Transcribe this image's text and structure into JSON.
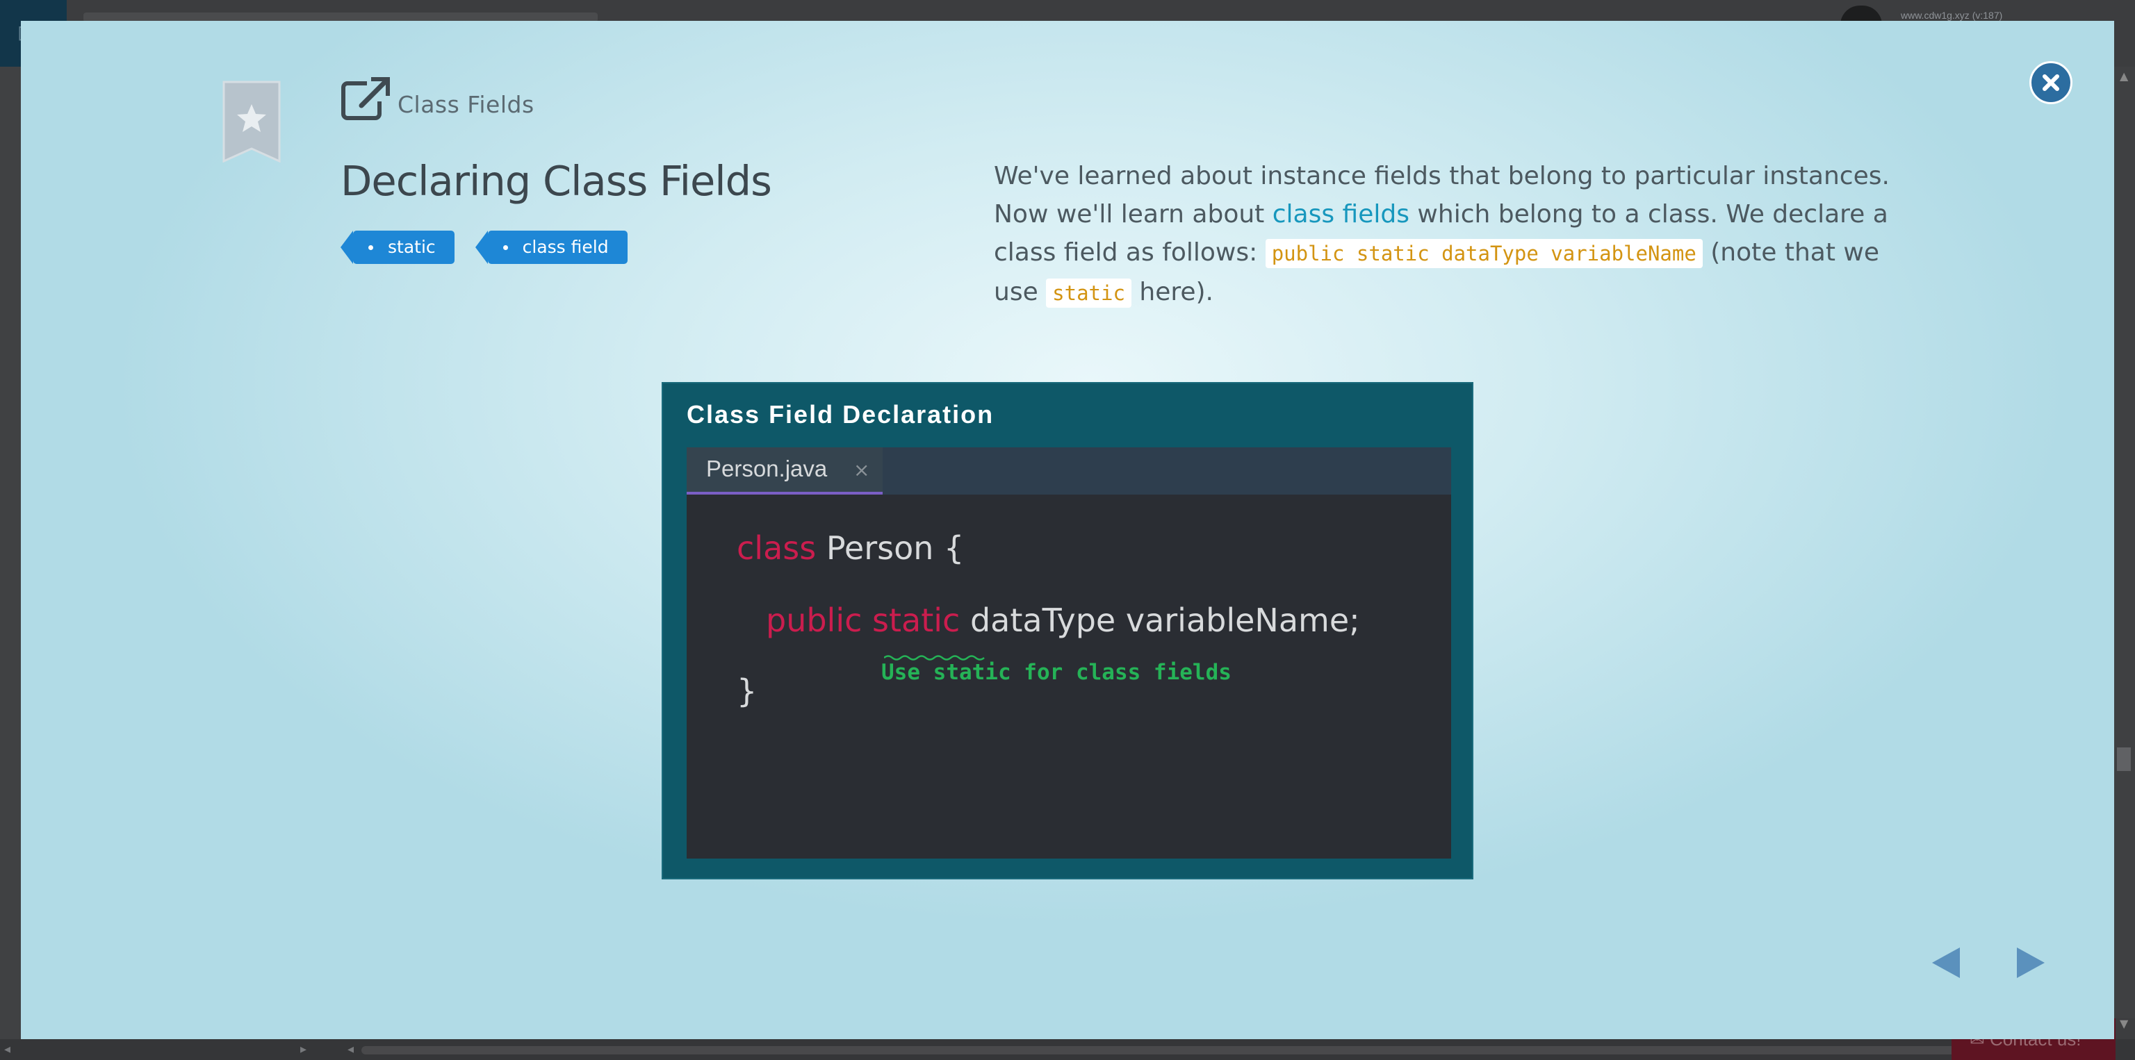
{
  "background": {
    "url_text": "www.cdw1g.xyz (v:187)",
    "contact_label": "Contact us!"
  },
  "modal": {
    "section_label": "Class Fields",
    "title": "Declaring Class Fields",
    "tags": [
      {
        "label": "static"
      },
      {
        "label": "class field"
      }
    ],
    "description": {
      "part1": "We've learned about instance fields that belong to particular instances. Now we'll learn about ",
      "link": "class fields",
      "part2": " which belong to a class. We declare a class field as follows: ",
      "code1": "public static dataType variableName",
      "part3": " (note that we use ",
      "code2": "static",
      "part4": " here)."
    },
    "slide": {
      "title": "Class Field Declaration",
      "file_tab": "Person.java",
      "tab_close": "×",
      "code": {
        "line1_kw": "class",
        "line1_rest": " Person {",
        "line2_kw1": "public",
        "line2_kw2": "static",
        "line2_rest": " dataType variableName;",
        "line3": "}"
      },
      "annotation": "Use static for class fields"
    }
  },
  "colors": {
    "accent_blue": "#1e87d6",
    "link_cyan": "#1797bd",
    "code_orange": "#d39412",
    "keyword_red": "#cb1d4e",
    "annotation_green": "#25b357",
    "close_button": "#2c6da0",
    "slide_teal": "#0e5868"
  },
  "icons": [
    "bookmark-star-icon",
    "close-icon",
    "external-link-icon",
    "prev-arrow-icon",
    "next-arrow-icon"
  ]
}
